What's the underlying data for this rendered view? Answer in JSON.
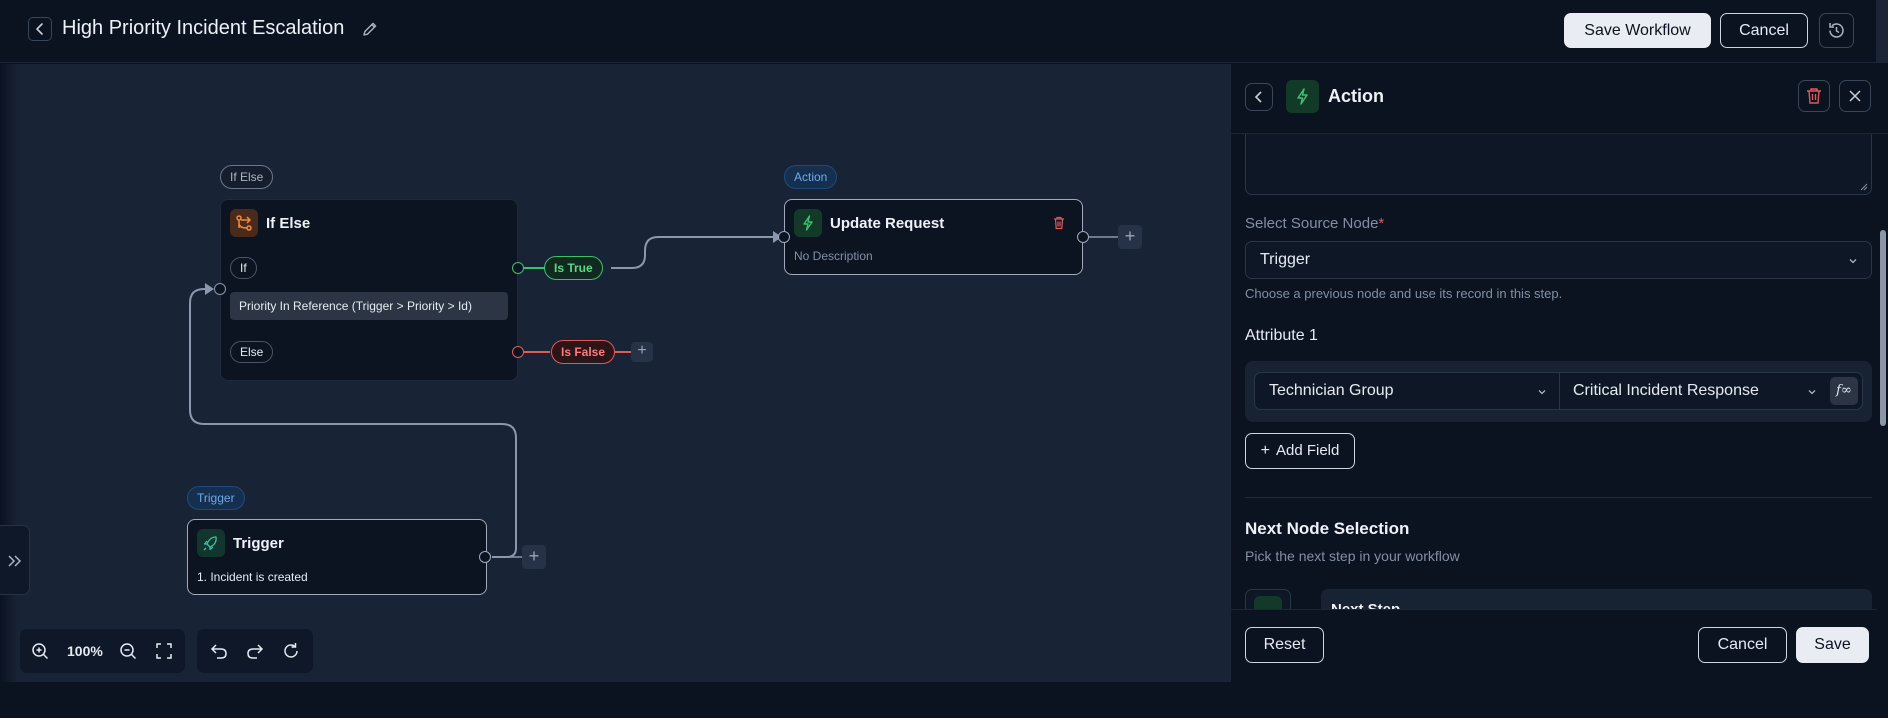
{
  "header": {
    "title": "High Priority Incident Escalation",
    "save_workflow": "Save Workflow",
    "cancel": "Cancel"
  },
  "canvas": {
    "if_else_tag": "If Else",
    "if_else_title": "If Else",
    "if_chip": "If",
    "condition": "Priority In Reference (Trigger > Priority > Id)",
    "else_chip": "Else",
    "is_true": "Is True",
    "is_false": "Is False",
    "action_tag": "Action",
    "action_title": "Update Request",
    "action_desc": "No Description",
    "trigger_tag": "Trigger",
    "trigger_title": "Trigger",
    "trigger_desc": "1. Incident is created",
    "zoom": "100%",
    "plus": "+"
  },
  "panel": {
    "title": "Action",
    "source_label": "Select Source Node",
    "required_mark": "*",
    "source_value": "Trigger",
    "source_help": "Choose a previous node and use its record in this step.",
    "attribute_label": "Attribute 1",
    "attr_field": "Technician Group",
    "attr_value": "Critical Incident Response",
    "fx": "f∞",
    "add_field": "Add Field",
    "next_title": "Next Node Selection",
    "next_help": "Pick the next step in your workflow",
    "next_item": "Next Step",
    "reset": "Reset",
    "cancel": "Cancel",
    "save": "Save"
  },
  "colors": {
    "accent_green": "#3fbf6e",
    "accent_red": "#e05a5a",
    "accent_orange": "#f08a3c",
    "accent_blue": "#6fa8ea",
    "canvas_bg": "#182436",
    "app_bg": "#0b1220"
  },
  "icons": [
    "chevron-left-icon",
    "pencil-icon",
    "history-icon",
    "trash-icon",
    "close-icon",
    "lightning-icon",
    "branch-icon",
    "rocket-icon",
    "zoom-in-icon",
    "zoom-out-icon",
    "fullscreen-icon",
    "undo-icon",
    "redo-icon",
    "refresh-icon",
    "double-chevron-right-icon",
    "chevron-down-icon",
    "plus-icon"
  ]
}
